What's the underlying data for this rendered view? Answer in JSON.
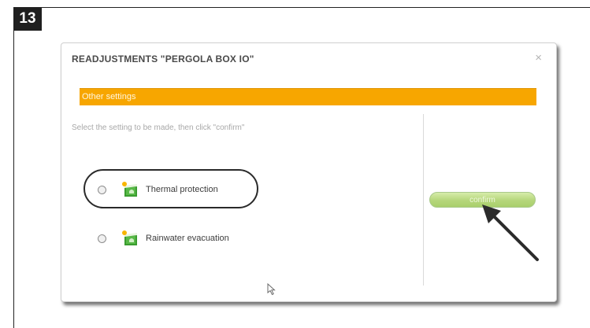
{
  "step_number": "13",
  "dialog": {
    "title": "READJUSTMENTS \"PERGOLA BOX IO\"",
    "close_glyph": "×",
    "section_title": "Other settings",
    "instruction": "Select the setting to be made, then click \"confirm\"",
    "options": [
      {
        "label": "Thermal protection",
        "icon": "thermal-protection-icon",
        "selected": false,
        "highlighted": true
      },
      {
        "label": "Rainwater evacuation",
        "icon": "rainwater-evacuation-icon",
        "selected": false,
        "highlighted": false
      }
    ],
    "confirm_label": "confirm"
  },
  "colors": {
    "section_bar": "#f7a600",
    "confirm_button": "#b5d67a",
    "icon_green": "#3a9c2f",
    "icon_sun": "#f7b500",
    "frame": "#222222"
  }
}
